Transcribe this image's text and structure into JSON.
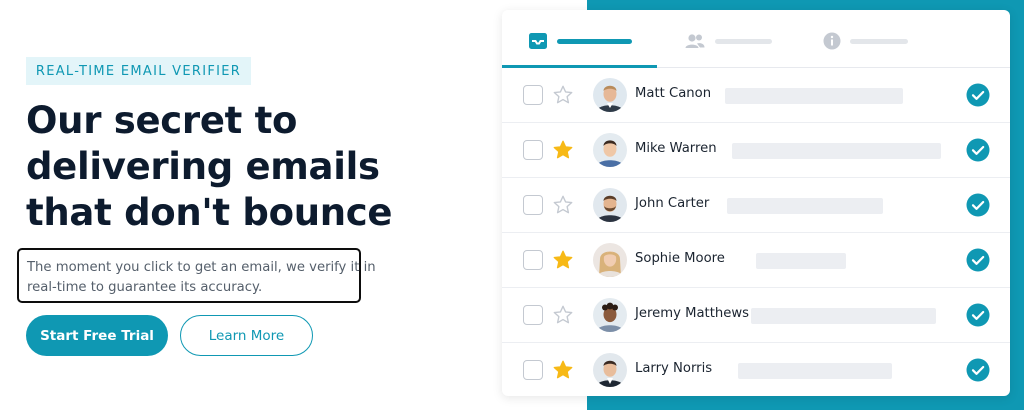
{
  "hero": {
    "badge": "REAL-TIME EMAIL VERIFIER",
    "headline_lines": [
      "Our secret to",
      "delivering emails",
      "that don't bounce"
    ],
    "description_lines": [
      "The moment you click to get an email, we verify it in",
      "real-time to guarantee its accuracy."
    ],
    "primary_button": "Start Free Trial",
    "secondary_button": "Learn More"
  },
  "colors": {
    "accent": "#0f98b3",
    "headline": "#0d1b2e",
    "star_filled": "#f7b916",
    "star_empty": "#c4c9d1",
    "placeholder": "#eceef2"
  },
  "panel": {
    "tabs": [
      {
        "icon": "inbox-icon",
        "active": true
      },
      {
        "icon": "users-icon",
        "active": false
      },
      {
        "icon": "info-icon",
        "active": false
      }
    ],
    "contacts": [
      {
        "name": "Matt Canon",
        "starred": false,
        "verified": true,
        "avatar": "avatar-man-light-hair"
      },
      {
        "name": "Mike Warren",
        "starred": true,
        "verified": true,
        "avatar": "avatar-man-dark-hair"
      },
      {
        "name": "John Carter",
        "starred": false,
        "verified": true,
        "avatar": "avatar-man-beard"
      },
      {
        "name": "Sophie Moore",
        "starred": true,
        "verified": true,
        "avatar": "avatar-woman-blonde"
      },
      {
        "name": "Jeremy Matthews",
        "starred": false,
        "verified": true,
        "avatar": "avatar-man-curly-hair"
      },
      {
        "name": "Larry Norris",
        "starred": true,
        "verified": true,
        "avatar": "avatar-man-suit"
      }
    ]
  }
}
